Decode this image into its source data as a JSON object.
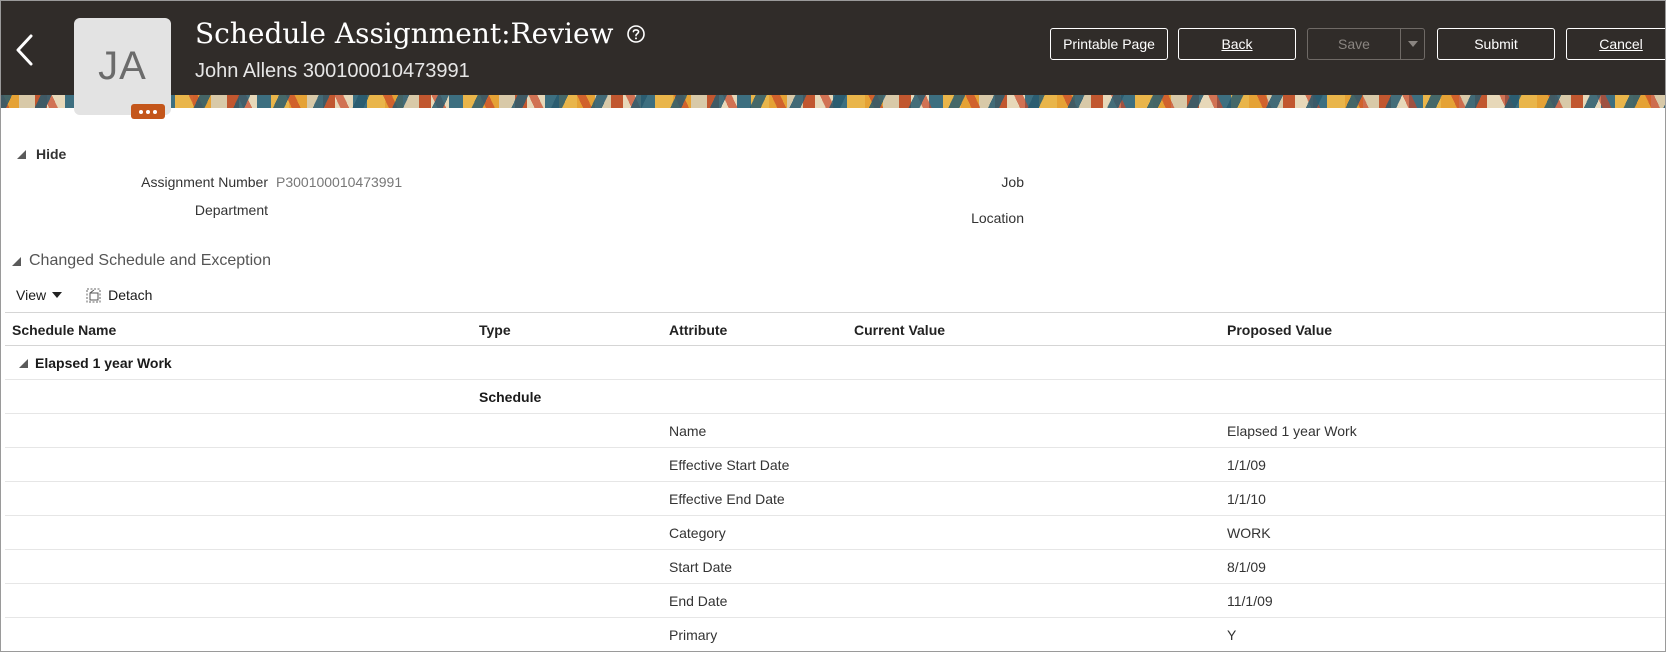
{
  "header": {
    "title": "Schedule Assignment:Review",
    "subtitle": "John Allens 300100010473991",
    "avatar_initials": "JA",
    "buttons": {
      "printable_page": "Printable Page",
      "back": "Back",
      "save": "Save",
      "submit": "Submit",
      "cancel": "Cancel"
    }
  },
  "details": {
    "hide_label": "Hide",
    "assignment_number_label": "Assignment Number",
    "assignment_number_value": "P300100010473991",
    "department_label": "Department",
    "job_label": "Job",
    "location_label": "Location"
  },
  "section": {
    "title": "Changed Schedule and Exception",
    "view_label": "View",
    "detach_label": "Detach"
  },
  "table": {
    "columns": [
      "Schedule Name",
      "Type",
      "Attribute",
      "Current Value",
      "Proposed Value"
    ],
    "group": "Elapsed 1 year Work",
    "type_label": "Schedule",
    "rows": [
      {
        "attribute": "Name",
        "current": "",
        "proposed": "Elapsed 1 year Work"
      },
      {
        "attribute": "Effective Start Date",
        "current": "",
        "proposed": "1/1/09"
      },
      {
        "attribute": "Effective End Date",
        "current": "",
        "proposed": "1/1/10"
      },
      {
        "attribute": "Category",
        "current": "",
        "proposed": "WORK"
      },
      {
        "attribute": "Start Date",
        "current": "",
        "proposed": "8/1/09"
      },
      {
        "attribute": "End Date",
        "current": "",
        "proposed": "11/1/09"
      },
      {
        "attribute": "Primary",
        "current": "",
        "proposed": "Y"
      }
    ]
  },
  "colors": {
    "header_bg": "#302c29",
    "avatar_badge": "#c4561b"
  },
  "icons": [
    "back-arrow-icon",
    "help-icon",
    "more-icon",
    "chevron-down-icon",
    "detach-icon",
    "collapse-triangle-icon"
  ]
}
